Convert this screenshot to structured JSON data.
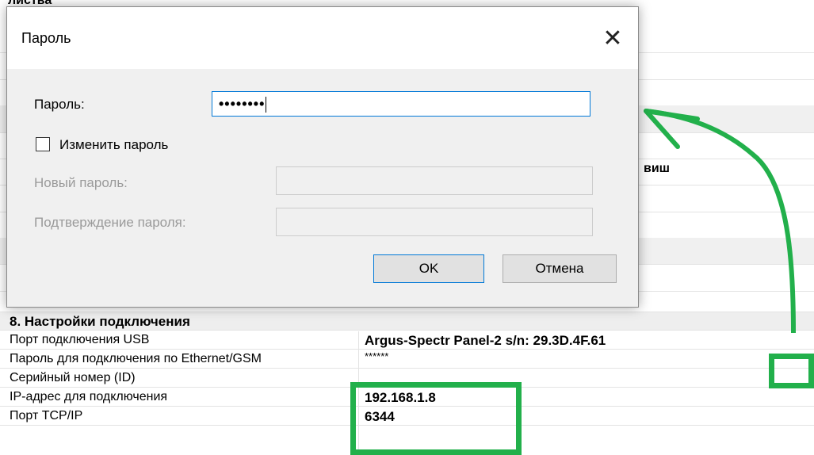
{
  "background": {
    "partial_title": "листва",
    "partial_value": "виш",
    "section_header": "8. Настройки подключения",
    "rows": [
      {
        "key": "Порт подключения USB",
        "value": "Argus-Spectr Panel-2 s/n: 29.3D.4F.61"
      },
      {
        "key": "Пароль для подключения по Ethernet/GSM",
        "value": "******"
      },
      {
        "key": "Серийный номер (ID)",
        "value": ""
      },
      {
        "key": "IP-адрес для подключения",
        "value": "192.168.1.8"
      },
      {
        "key": "Порт TCP/IP",
        "value": "6344"
      }
    ]
  },
  "dialog": {
    "title": "Пароль",
    "close_glyph": "✕",
    "password_label": "Пароль:",
    "password_value": "••••••••",
    "change_password_label": "Изменить пароль",
    "change_password_checked": false,
    "new_password_label": "Новый пароль:",
    "confirm_password_label": "Подтверждение пароля:",
    "ok_label": "OK",
    "cancel_label": "Отмена"
  },
  "annotation": {
    "color": "#22b04b"
  }
}
